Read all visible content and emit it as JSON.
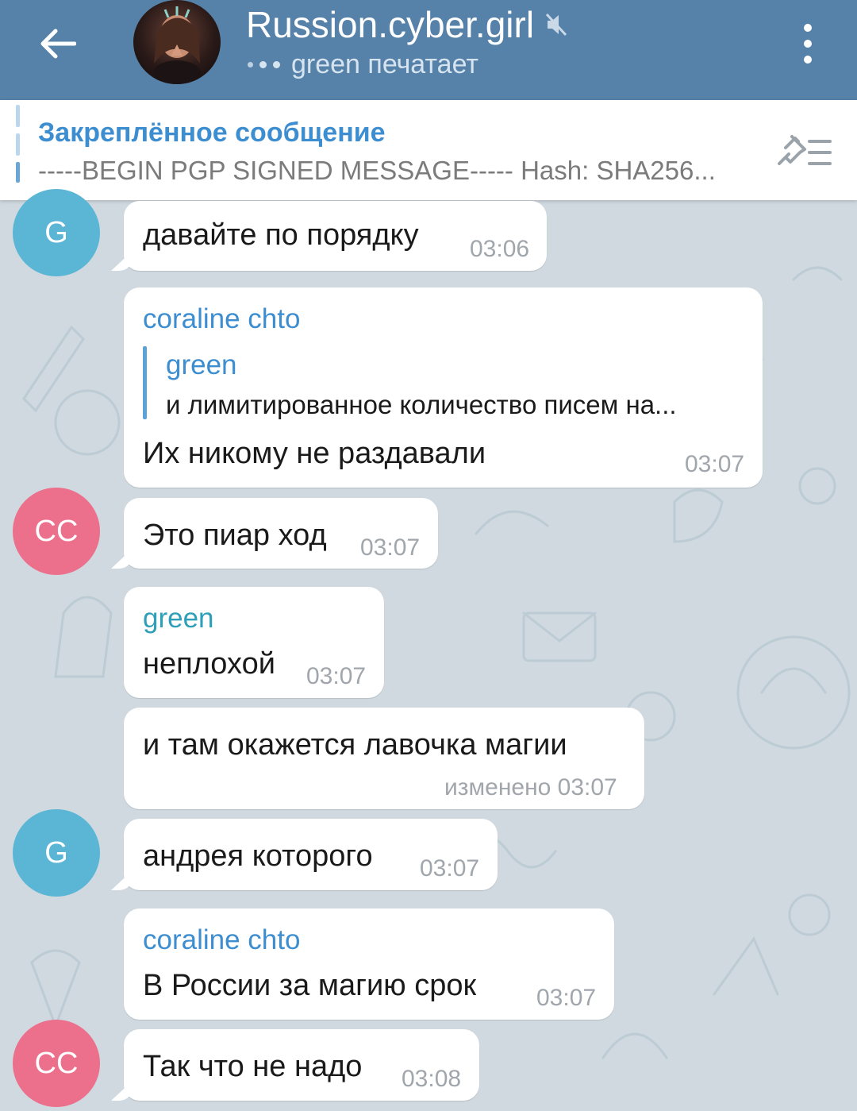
{
  "header": {
    "title": "Russion.cyber.girl",
    "subtitle": "green печатает",
    "colors": {
      "bar": "#5681a8"
    }
  },
  "pinned": {
    "title": "Закреплённое сообщение",
    "text": "-----BEGIN PGP SIGNED MESSAGE----- Hash: SHA256..."
  },
  "avatars": {
    "g": {
      "initial": "G",
      "color": "#5bb6d6"
    },
    "cc": {
      "initial": "CC",
      "color": "#ec6f8c"
    }
  },
  "messages": [
    {
      "text": "давайте по порядку",
      "time": "03:06"
    },
    {
      "sender": "coraline chto",
      "reply_name": "green",
      "reply_text": "и лимитированное количество писем на...",
      "text": "Их никому не раздавали",
      "time": "03:07"
    },
    {
      "text": "Это пиар ход",
      "time": "03:07"
    },
    {
      "sender": "green",
      "text": "неплохой",
      "time": "03:07"
    },
    {
      "text": "и там окажется лавочка магии",
      "time": "изменено 03:07"
    },
    {
      "text": "андрея которого",
      "time": "03:07"
    },
    {
      "sender": "coraline chto",
      "text": "В России за магию срок",
      "time": "03:07"
    },
    {
      "text": "Так что не надо",
      "time": "03:08"
    }
  ],
  "sender_colors": {
    "coraline chto": "#3d8ed0",
    "green": "#2e9fb8"
  }
}
